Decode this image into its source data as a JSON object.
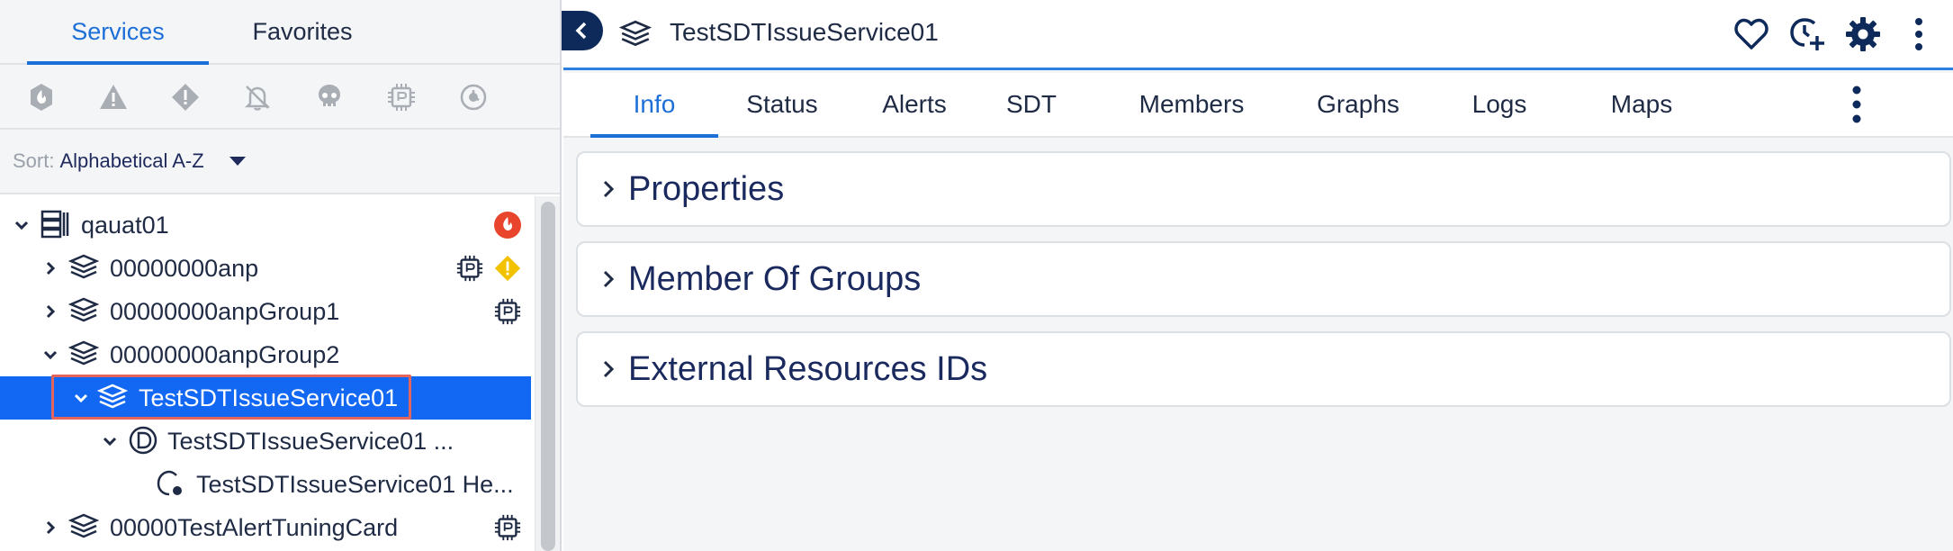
{
  "left_panel": {
    "tabs": [
      {
        "label": "Services",
        "active": true
      },
      {
        "label": "Favorites",
        "active": false
      }
    ],
    "filter_icons": [
      "critical-alert-icon",
      "error-alert-icon",
      "warning-alert-icon",
      "muted-bell-icon",
      "dead-skull-icon",
      "sdt-chip-icon",
      "cleared-clock-icon"
    ],
    "sort": {
      "label": "Sort:",
      "value": "Alphabetical A-Z"
    },
    "tree": [
      {
        "label": "qauat01",
        "icon": "group-icon",
        "expanded": true,
        "badges": [
          "critical-badge"
        ]
      },
      {
        "label": "00000000anp",
        "icon": "service-stack-icon",
        "expanded": false,
        "badges": [
          "sdt-badge",
          "warning-badge"
        ]
      },
      {
        "label": "00000000anpGroup1",
        "icon": "service-stack-icon",
        "expanded": false,
        "badges": [
          "sdt-badge"
        ]
      },
      {
        "label": "00000000anpGroup2",
        "icon": "service-stack-icon",
        "expanded": true,
        "badges": []
      },
      {
        "label": "TestSDTIssueService01",
        "icon": "service-stack-icon",
        "expanded": true,
        "selected": true,
        "badges": []
      },
      {
        "label": "TestSDTIssueService01 ...",
        "icon": "datasource-d-icon",
        "expanded": true,
        "badges": []
      },
      {
        "label": "TestSDTIssueService01 He...",
        "icon": "instance-icon",
        "badges": []
      },
      {
        "label": "00000TestAlertTuningCard",
        "icon": "service-stack-icon",
        "expanded": false,
        "badges": [
          "sdt-badge"
        ]
      }
    ]
  },
  "header": {
    "title": "TestSDTIssueService01",
    "icons": [
      "heart-icon",
      "add-sdt-clock-icon",
      "gear-icon",
      "more-vertical-icon"
    ]
  },
  "tabs": [
    {
      "label": "Info",
      "active": true
    },
    {
      "label": "Status"
    },
    {
      "label": "Alerts"
    },
    {
      "label": "SDT"
    },
    {
      "label": "Members"
    },
    {
      "label": "Graphs"
    },
    {
      "label": "Logs"
    },
    {
      "label": "Maps"
    }
  ],
  "sections": [
    {
      "title": "Properties"
    },
    {
      "title": "Member Of Groups"
    },
    {
      "title": "External Resources IDs"
    }
  ],
  "colors": {
    "accent": "#1d6fd8",
    "selected_row": "#1268f3",
    "critical": "#e8452c",
    "warning": "#f2c200",
    "navy": "#0e2a5a",
    "highlight_box": "#e4655b"
  }
}
